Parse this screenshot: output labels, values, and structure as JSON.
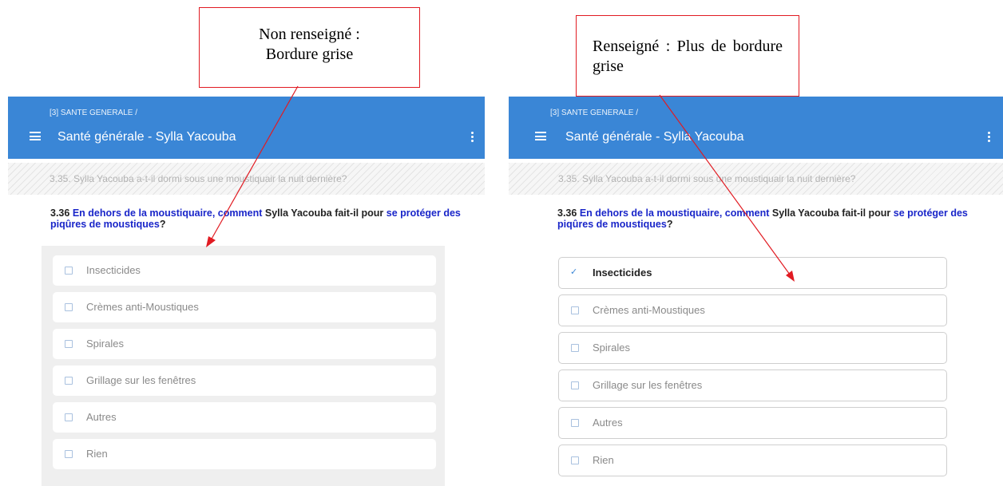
{
  "left": {
    "breadcrumb": "[3] SANTE GENERALE /",
    "title": "Santé générale - Sylla Yacouba",
    "prev_question": "3.35. Sylla Yacouba a-t-il dormi sous une moustiquair la nuit dernière?",
    "question": {
      "number": "3.36",
      "part1": "En dehors de la moustiquaire, comment",
      "part2": "Sylla Yacouba fait-il pour",
      "part3": "se protéger des piqûres de moustiques",
      "end": "?"
    },
    "options": [
      {
        "label": "Insecticides",
        "checked": false
      },
      {
        "label": "Crèmes anti-Moustiques",
        "checked": false
      },
      {
        "label": "Spirales",
        "checked": false
      },
      {
        "label": "Grillage sur les fenêtres",
        "checked": false
      },
      {
        "label": "Autres",
        "checked": false
      },
      {
        "label": "Rien",
        "checked": false
      }
    ]
  },
  "right": {
    "breadcrumb": "[3] SANTE GENERALE /",
    "title": "Santé générale - Sylla Yacouba",
    "prev_question": "3.35. Sylla Yacouba a-t-il dormi sous une moustiquair la nuit dernière?",
    "question": {
      "number": "3.36",
      "part1": "En dehors de la moustiquaire, comment",
      "part2": "Sylla Yacouba fait-il pour",
      "part3": "se protéger des piqûres de moustiques",
      "end": "?"
    },
    "options": [
      {
        "label": "Insecticides",
        "checked": true
      },
      {
        "label": "Crèmes anti-Moustiques",
        "checked": false
      },
      {
        "label": "Spirales",
        "checked": false
      },
      {
        "label": "Grillage sur les fenêtres",
        "checked": false
      },
      {
        "label": "Autres",
        "checked": false
      },
      {
        "label": "Rien",
        "checked": false
      }
    ]
  },
  "callouts": {
    "left_line1": "Non renseigné :",
    "left_line2": "Bordure grise",
    "right_text": "Renseigné : Plus de bordure grise"
  },
  "colors": {
    "appbar": "#3a86d6",
    "callout_border": "#e11b22",
    "question_highlight": "#1a26c9"
  }
}
